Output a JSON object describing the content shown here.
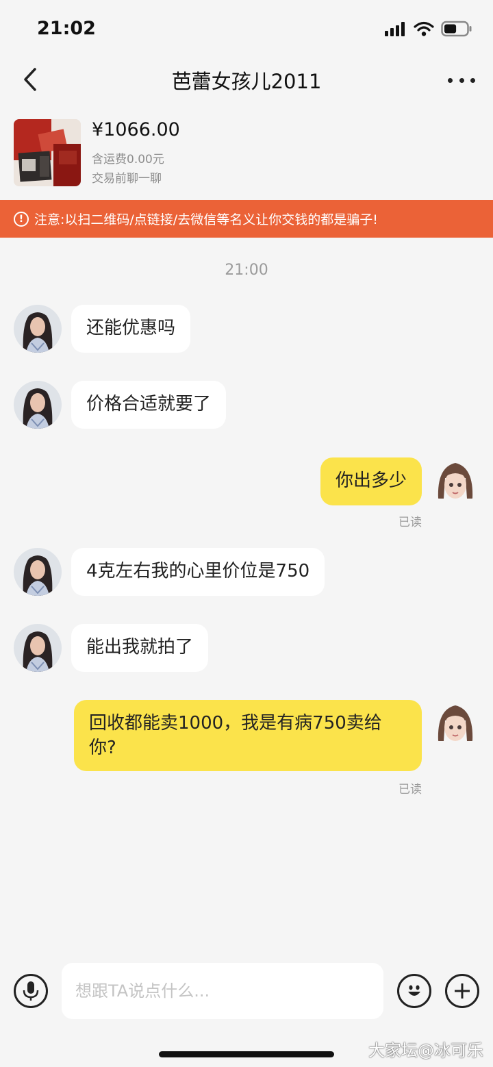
{
  "status_bar": {
    "time": "21:02",
    "battery_level": 0.55
  },
  "header": {
    "title": "芭蕾女孩儿2011"
  },
  "product": {
    "price": "¥1066.00",
    "shipping": "含运费0.00元",
    "chat_hint": "交易前聊一聊"
  },
  "warning": {
    "text": "注意:以扫二维码/点链接/去微信等名义让你交钱的都是骗子!"
  },
  "time_separator": "21:00",
  "messages": [
    {
      "side": "in",
      "text": "还能优惠吗"
    },
    {
      "side": "in",
      "text": "价格合适就要了"
    },
    {
      "side": "out",
      "text": "你出多少",
      "status": "已读"
    },
    {
      "side": "in",
      "text": "4克左右我的心里价位是750"
    },
    {
      "side": "in",
      "text": "能出我就拍了"
    },
    {
      "side": "out",
      "text": "回收都能卖1000，我是有病750卖给你?",
      "status": "已读"
    }
  ],
  "input": {
    "placeholder": "想跟TA说点什么..."
  },
  "watermark": "大家坛@冰可乐",
  "colors": {
    "background": "#f5f5f5",
    "warning": "#eb6237",
    "outgoing_bubble": "#fbe34b",
    "incoming_bubble": "#ffffff"
  },
  "icons": {
    "back": "chevron-left-icon",
    "more": "more-icon",
    "voice": "microphone-icon",
    "emoji": "emoji-icon",
    "add": "plus-icon"
  }
}
